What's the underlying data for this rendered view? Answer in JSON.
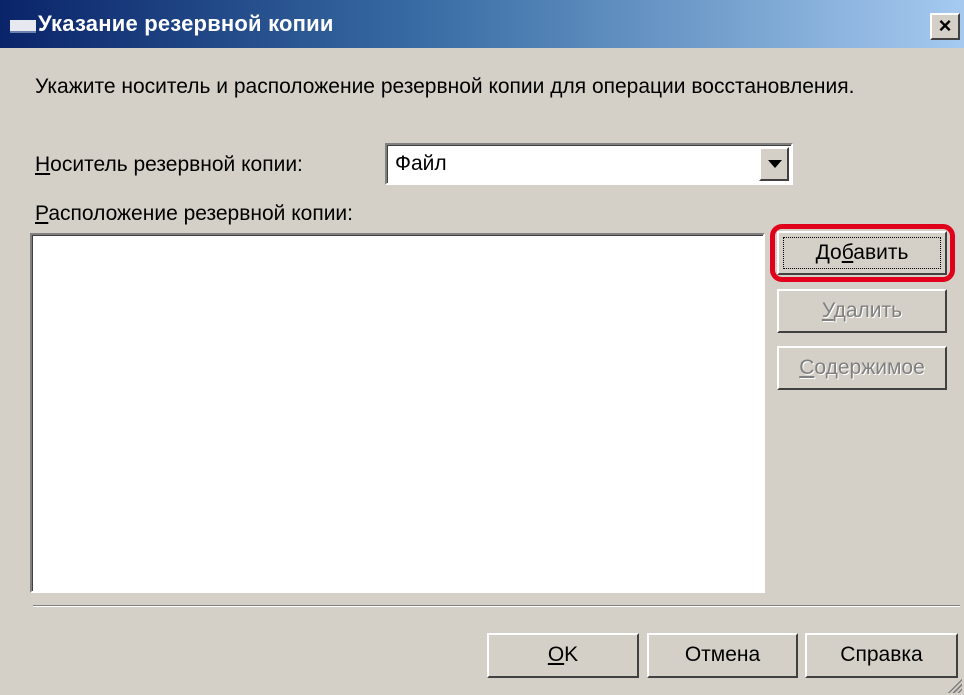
{
  "window": {
    "title": "Указание резервной копии",
    "close_glyph": "×"
  },
  "instruction": "Укажите носитель и расположение резервной копии для операции восстановления.",
  "media": {
    "label_accel": "Н",
    "label_rest": "оситель резервной копии:",
    "selected": "Файл"
  },
  "location": {
    "label_accel": "Р",
    "label_rest": "асположение резервной копии:",
    "items": []
  },
  "side_buttons": {
    "add": {
      "pre": "До",
      "accel": "б",
      "post": "авить"
    },
    "remove": {
      "pre": "",
      "accel": "У",
      "post": "далить"
    },
    "contents": {
      "pre": "",
      "accel": "С",
      "post": "одержимое"
    }
  },
  "footer": {
    "ok": {
      "accel": "O",
      "post": "K"
    },
    "cancel": "Отмена",
    "help": "Справка"
  },
  "colors": {
    "title_gradient_start": "#0a246a",
    "title_gradient_end": "#a6caf0",
    "dialog_bg": "#d4d0c8",
    "highlight": "#e0001b"
  }
}
